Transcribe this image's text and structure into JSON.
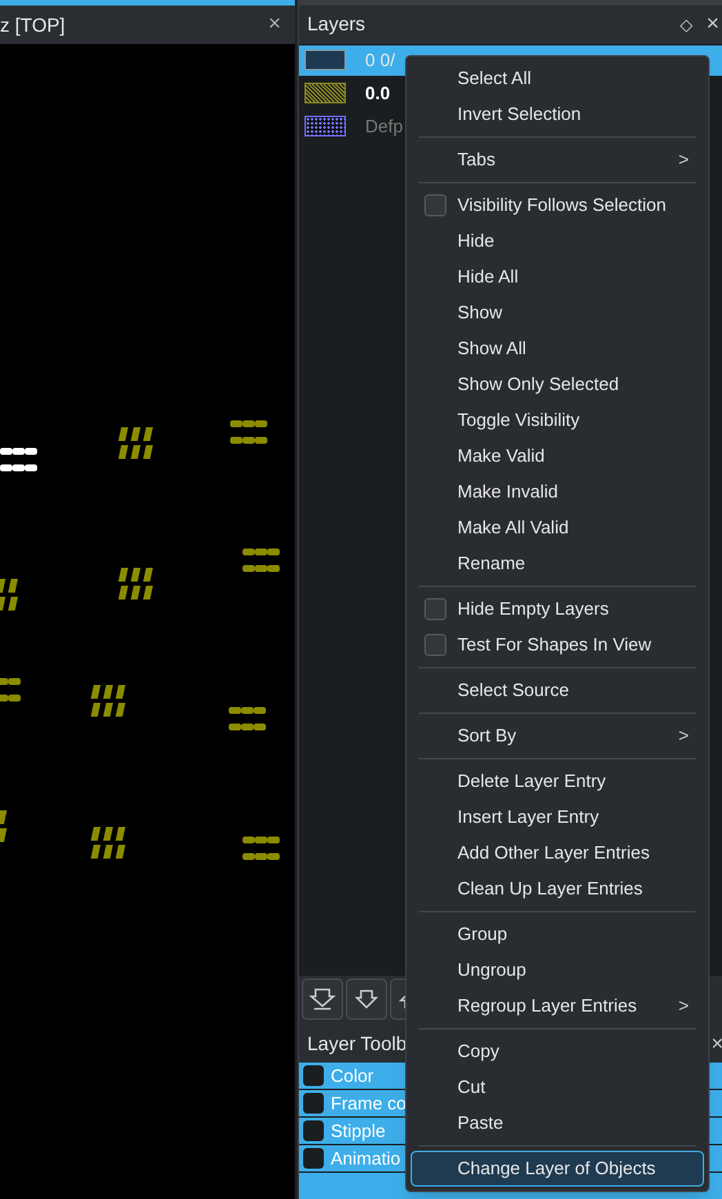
{
  "layout_view": {
    "title": "z [TOP]",
    "close": "×"
  },
  "layers_panel": {
    "title": "Layers",
    "float": "◇",
    "close": "×",
    "layers": [
      {
        "label": "0 0/",
        "kind": "solid",
        "color": "#1e3a52",
        "selected": true,
        "bold": false
      },
      {
        "label": "0.0",
        "kind": "hatch",
        "color": "#8a8a20",
        "selected": false,
        "bold": true
      },
      {
        "label": "Defp",
        "kind": "dots",
        "color": "#7070ff",
        "selected": false,
        "bold": false
      }
    ]
  },
  "layer_toolbox": {
    "title": "Layer Toolb",
    "close": "×",
    "rows": [
      {
        "label": "Color",
        "checked": false
      },
      {
        "label": "Frame co",
        "checked": false
      },
      {
        "label": "Stipple",
        "checked": false
      },
      {
        "label": "Animatio",
        "checked": false
      }
    ]
  },
  "context_menu": [
    {
      "kind": "action",
      "label": "Select All",
      "selected": false
    },
    {
      "kind": "action",
      "label": "Invert Selection",
      "selected": false
    },
    {
      "kind": "separator"
    },
    {
      "kind": "submenu",
      "label": "Tabs",
      "arrow": ">",
      "selected": false
    },
    {
      "kind": "separator"
    },
    {
      "kind": "check",
      "label": "Visibility Follows Selection",
      "checked": false,
      "selected": false
    },
    {
      "kind": "action",
      "label": "Hide",
      "selected": false
    },
    {
      "kind": "action",
      "label": "Hide All",
      "selected": false
    },
    {
      "kind": "action",
      "label": "Show",
      "selected": false
    },
    {
      "kind": "action",
      "label": "Show All",
      "selected": false
    },
    {
      "kind": "action",
      "label": "Show Only Selected",
      "selected": false
    },
    {
      "kind": "action",
      "label": "Toggle Visibility",
      "selected": false
    },
    {
      "kind": "action",
      "label": "Make Valid",
      "selected": false
    },
    {
      "kind": "action",
      "label": "Make Invalid",
      "selected": false
    },
    {
      "kind": "action",
      "label": "Make All Valid",
      "selected": false
    },
    {
      "kind": "action",
      "label": "Rename",
      "selected": false
    },
    {
      "kind": "separator"
    },
    {
      "kind": "check",
      "label": "Hide Empty Layers",
      "checked": false,
      "selected": false
    },
    {
      "kind": "check",
      "label": "Test For Shapes In View",
      "checked": false,
      "selected": false
    },
    {
      "kind": "separator"
    },
    {
      "kind": "action",
      "label": "Select Source",
      "selected": false
    },
    {
      "kind": "separator"
    },
    {
      "kind": "submenu",
      "label": "Sort By",
      "arrow": ">",
      "selected": false
    },
    {
      "kind": "separator"
    },
    {
      "kind": "action",
      "label": "Delete Layer Entry",
      "selected": false
    },
    {
      "kind": "action",
      "label": "Insert Layer Entry",
      "selected": false
    },
    {
      "kind": "action",
      "label": "Add Other Layer Entries",
      "selected": false
    },
    {
      "kind": "action",
      "label": "Clean Up Layer Entries",
      "selected": false
    },
    {
      "kind": "separator"
    },
    {
      "kind": "action",
      "label": "Group",
      "selected": false
    },
    {
      "kind": "action",
      "label": "Ungroup",
      "selected": false
    },
    {
      "kind": "submenu",
      "label": "Regroup Layer Entries",
      "arrow": ">",
      "selected": false
    },
    {
      "kind": "separator"
    },
    {
      "kind": "action",
      "label": "Copy",
      "selected": false
    },
    {
      "kind": "action",
      "label": "Cut",
      "selected": false
    },
    {
      "kind": "action",
      "label": "Paste",
      "selected": false
    },
    {
      "kind": "separator"
    },
    {
      "kind": "action",
      "label": "Change Layer of Objects",
      "selected": true
    }
  ]
}
